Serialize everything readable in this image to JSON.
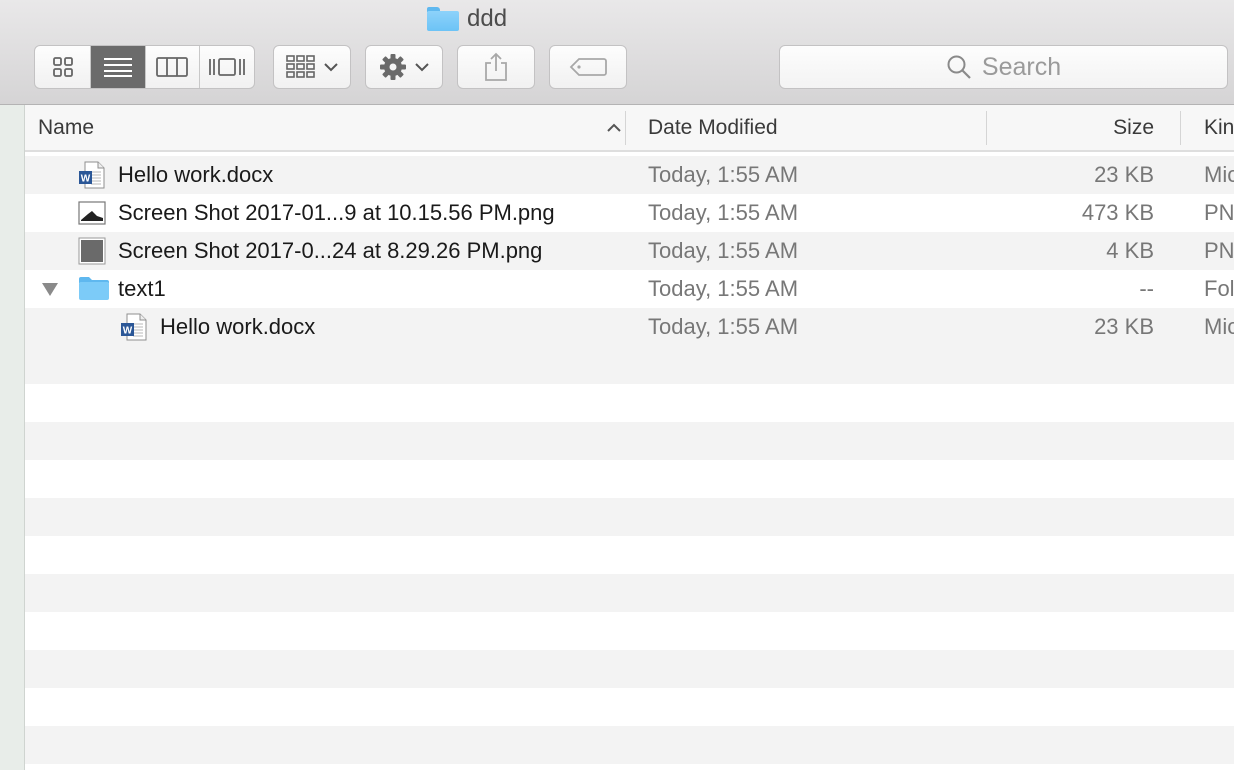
{
  "window": {
    "title": "ddd",
    "title_icon": "folder-icon"
  },
  "toolbar": {
    "view_modes": [
      {
        "name": "icon-view",
        "icon": "grid-icon",
        "active": false
      },
      {
        "name": "list-view",
        "icon": "list-icon",
        "active": true
      },
      {
        "name": "column-view",
        "icon": "columns-icon",
        "active": false
      },
      {
        "name": "gallery-view",
        "icon": "cover-flow-icon",
        "active": false
      }
    ],
    "arrange_icon": "arrange-grid-icon",
    "action_icon": "gear-icon",
    "share_icon": "share-icon",
    "tags_icon": "tag-icon",
    "search": {
      "placeholder": "Search",
      "icon": "magnifier-icon"
    }
  },
  "columns": {
    "name": "Name",
    "date": "Date Modified",
    "size": "Size",
    "kind": "Kin"
  },
  "files": [
    {
      "name": "Hello work.docx",
      "date": "Today, 1:55 AM",
      "size": "23 KB",
      "kind": "Mic",
      "icon": "word-document-icon",
      "indent": 0,
      "expanded": null
    },
    {
      "name": "Screen Shot 2017-01...9 at 10.15.56 PM.png",
      "date": "Today, 1:55 AM",
      "size": "473 KB",
      "kind": "PN",
      "icon": "image-thumbnail-icon",
      "indent": 0,
      "expanded": null
    },
    {
      "name": "Screen Shot 2017-0...24 at 8.29.26 PM.png",
      "date": "Today, 1:55 AM",
      "size": "4 KB",
      "kind": "PN",
      "icon": "image-thumbnail-dark-icon",
      "indent": 0,
      "expanded": null
    },
    {
      "name": "text1",
      "date": "Today, 1:55 AM",
      "size": "--",
      "kind": "Fol",
      "icon": "folder-icon",
      "indent": 0,
      "expanded": true
    },
    {
      "name": "Hello work.docx",
      "date": "Today, 1:55 AM",
      "size": "23 KB",
      "kind": "Mic",
      "icon": "word-document-icon",
      "indent": 1,
      "expanded": null
    }
  ],
  "colors": {
    "active_segment": "#6b6b6b",
    "folder_blue": "#6cc3f6",
    "word_blue": "#2b5797"
  }
}
